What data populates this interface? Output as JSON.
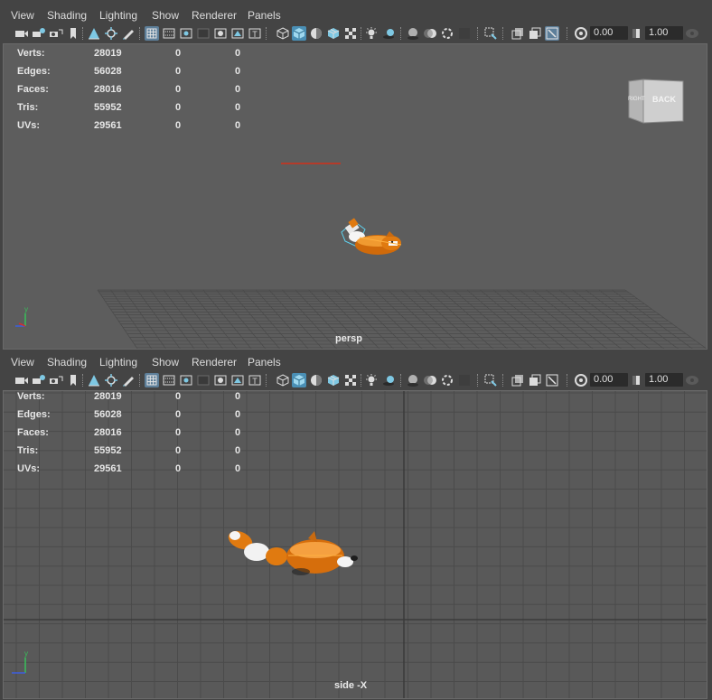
{
  "menus": [
    "View",
    "Shading",
    "Lighting",
    "Show",
    "Renderer",
    "Panels"
  ],
  "toolbar": {
    "exposure_value": "0.00",
    "gamma_value": "1.00",
    "icons": [
      "select-camera-icon",
      "camera-attributes-icon",
      "bookmark-icon",
      "bookmark-ribbon-icon",
      "image-plane-icon",
      "2d-pan-zoom-icon",
      "grease-pencil-icon",
      "grid-icon",
      "film-gate-icon",
      "resolution-gate-icon",
      "gate-mask-icon",
      "field-chart-icon",
      "safe-action-icon",
      "safe-title-icon",
      "wireframe-icon",
      "smooth-shade-icon",
      "default-material-icon",
      "wireframe-on-shaded-icon",
      "textured-icon",
      "use-all-lights-icon",
      "shadows-icon",
      "ambient-occlusion-icon",
      "motion-blur-icon",
      "anti-aliasing-icon",
      "depth-of-field-icon",
      "isolate-select-icon",
      "xray-icon",
      "xray-joints-icon",
      "xray-components-icon",
      "exposure-icon",
      "gamma-icon",
      "view-transform-icon"
    ]
  },
  "hud": {
    "rows": [
      {
        "label": "Verts:",
        "c1": "28019",
        "c2": "0",
        "c3": "0"
      },
      {
        "label": "Edges:",
        "c1": "56028",
        "c2": "0",
        "c3": "0"
      },
      {
        "label": "Faces:",
        "c1": "28016",
        "c2": "0",
        "c3": "0"
      },
      {
        "label": "Tris:",
        "c1": "55952",
        "c2": "0",
        "c3": "0"
      },
      {
        "label": "UVs:",
        "c1": "29561",
        "c2": "0",
        "c3": "0"
      }
    ]
  },
  "top_viewport": {
    "camera_label": "persp",
    "viewcube_front": "BACK",
    "viewcube_side": "RIGHT",
    "axis_label": "y"
  },
  "bottom_viewport": {
    "camera_label": "side -X",
    "axis_label": "y"
  },
  "colors": {
    "viewport_bg": "#5d5d5d",
    "ui_bg": "#444444",
    "model_orange": "#e07a10",
    "selection_cyan": "#5fd3f0"
  }
}
